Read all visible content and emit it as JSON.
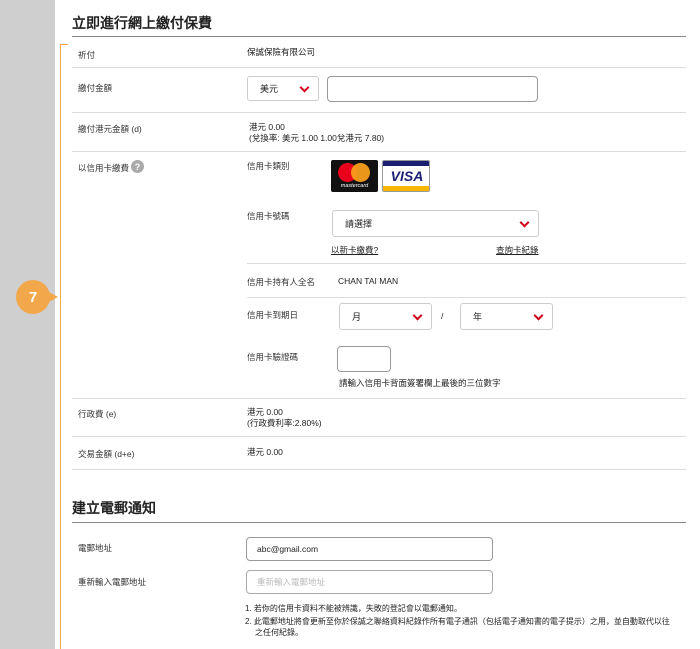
{
  "step": {
    "number": "7"
  },
  "payment": {
    "title": "立即進行網上繳付保費",
    "payee": {
      "label": "祈付",
      "value": "保誠保險有限公司"
    },
    "amount": {
      "label": "繳付金額",
      "currency": "美元",
      "value": ""
    },
    "hkd_amount": {
      "label": "繳付港元金額 (d)",
      "value": "港元 0.00",
      "rate": "(兌換率: 美元 1.00 1.00兌港元 7.80)"
    },
    "credit_card": {
      "label": "以信用卡繳費",
      "help": "?",
      "type_label": "信用卡類別",
      "card_logos": {
        "mastercard": "mastercard",
        "visa": "VISA"
      },
      "number_label": "信用卡號碼",
      "number_select": "請選擇",
      "new_card_link": "以新卡繳費?",
      "history_link": "查詢卡紀錄",
      "holder_label": "信用卡持有人全名",
      "holder_name": "CHAN TAI MAN",
      "expiry_label": "信用卡到期日",
      "month": "月",
      "separator": "/",
      "year": "年",
      "cvv_label": "信用卡驗證碼",
      "cvv_value": "",
      "cvv_hint": "請輸入信用卡背面簽署欄上最後的三位數字"
    },
    "admin_fee": {
      "label": "行政費 (e)",
      "value": "港元 0.00",
      "rate": "(行政費利率:2.80%)"
    },
    "total": {
      "label": "交易金額 (d+e)",
      "value": "港元 0.00"
    }
  },
  "email": {
    "title": "建立電郵通知",
    "address_label": "電郵地址",
    "address_value": "abc@gmail.com",
    "confirm_label": "重新輸入電郵地址",
    "confirm_placeholder": "重新輸入電郵地址",
    "notes": [
      "1. 若你的信用卡資料不能被辨識，失敗的登記會以電郵通知。",
      "2. 此電郵地址將會更新至你於保誠之聯絡資料紀錄作所有電子通訊（包括電子通知書的電子提示）之用，並自動取代以往",
      "之任何紀錄。"
    ]
  },
  "colors": {
    "accent": "#f2a74a",
    "chevron": "#d0021b",
    "sidebar": "#cfcfcf"
  }
}
